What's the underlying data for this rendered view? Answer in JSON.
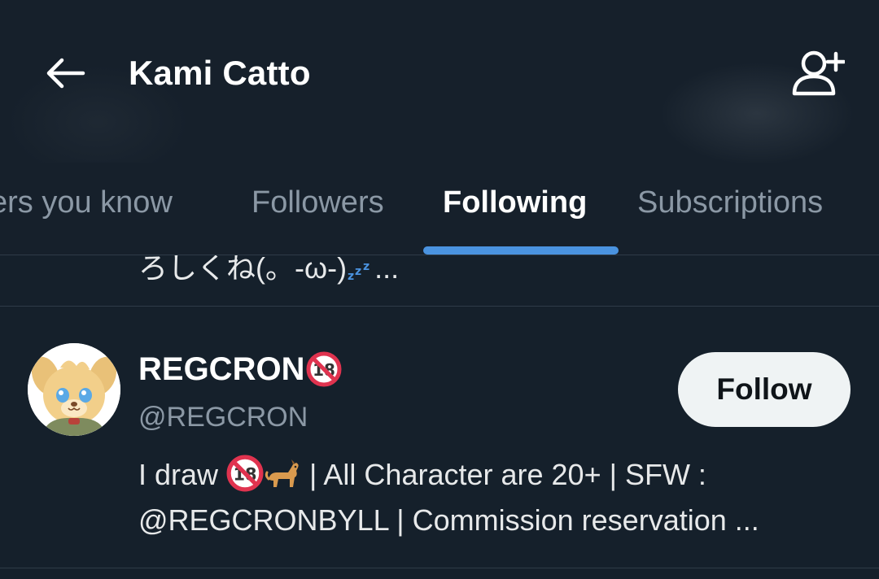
{
  "header": {
    "title": "Kami Catto",
    "back_icon": "arrow-left-icon",
    "add_user_icon": "add-user-icon"
  },
  "tabs": [
    {
      "label": "Followers you know",
      "visible_text": "ers you know",
      "active": false
    },
    {
      "label": "Followers",
      "active": false
    },
    {
      "label": "Following",
      "active": true
    },
    {
      "label": "Subscriptions",
      "active": false
    }
  ],
  "previous_item": {
    "bio_fragment": "ろしくね(。-ω-)",
    "bio_ellipsis": "..."
  },
  "user": {
    "name": "REGCRON",
    "name_badge_icon": "no-under-18-icon",
    "handle": "@REGCRON",
    "follow_label": "Follow",
    "bio_line1_start": "I draw ",
    "bio_line1_icons": [
      "no-under-18-icon",
      "dog-icon"
    ],
    "bio_line1_end": " | All Character are 20+ | SFW :",
    "bio_line2": "@REGCRONBYLL | Commission reservation ..."
  },
  "colors": {
    "background": "#15202b",
    "accent": "#4a93e0",
    "text_primary": "#e7e9ea",
    "text_secondary": "#8b98a5",
    "follow_button_bg": "#eff3f4",
    "divider": "#2f3b47"
  }
}
